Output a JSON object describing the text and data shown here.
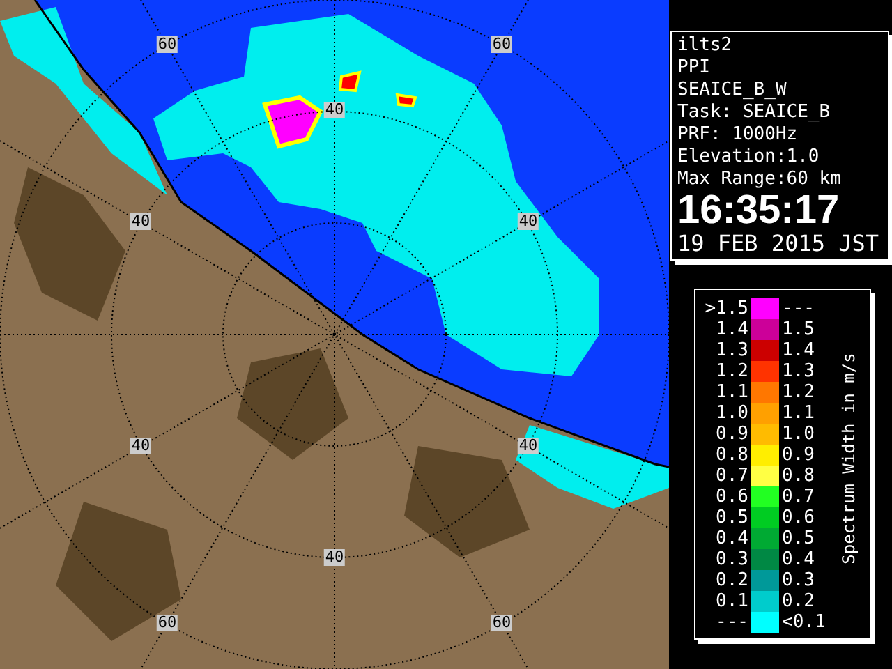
{
  "map": {
    "range_labels": [
      "60",
      "60",
      "40",
      "40",
      "40",
      "40",
      "40",
      "40",
      "60",
      "60"
    ]
  },
  "info_panel": {
    "lines": [
      "ilts2",
      "PPI",
      "SEAICE_B_W",
      "Task: SEAICE_B",
      "PRF: 1000Hz",
      "Elevation:1.0",
      "Max Range:60 km"
    ],
    "time": "16:35:17",
    "date": "19 FEB 2015 JST"
  },
  "legend": {
    "title": "Spectrum Width in m/s",
    "rows": [
      {
        "low": ">1.5",
        "high": "---",
        "color": "#ff00ff"
      },
      {
        "low": "1.4",
        "high": "1.5",
        "color": "#cc0099"
      },
      {
        "low": "1.3",
        "high": "1.4",
        "color": "#cc0000"
      },
      {
        "low": "1.2",
        "high": "1.3",
        "color": "#ff3300"
      },
      {
        "low": "1.1",
        "high": "1.2",
        "color": "#ff7700"
      },
      {
        "low": "1.0",
        "high": "1.1",
        "color": "#ffa000"
      },
      {
        "low": "0.9",
        "high": "1.0",
        "color": "#ffbb00"
      },
      {
        "low": "0.8",
        "high": "0.9",
        "color": "#ffee00"
      },
      {
        "low": "0.7",
        "high": "0.8",
        "color": "#ffff44"
      },
      {
        "low": "0.6",
        "high": "0.7",
        "color": "#22ff22"
      },
      {
        "low": "0.5",
        "high": "0.6",
        "color": "#00cc22"
      },
      {
        "low": "0.4",
        "high": "0.5",
        "color": "#00aa33"
      },
      {
        "low": "0.3",
        "high": "0.4",
        "color": "#008844"
      },
      {
        "low": "0.2",
        "high": "0.3",
        "color": "#009999"
      },
      {
        "low": "0.1",
        "high": "0.2",
        "color": "#00cccc"
      },
      {
        "low": "---",
        "high": "<0.1",
        "color": "#00ffff"
      }
    ]
  }
}
